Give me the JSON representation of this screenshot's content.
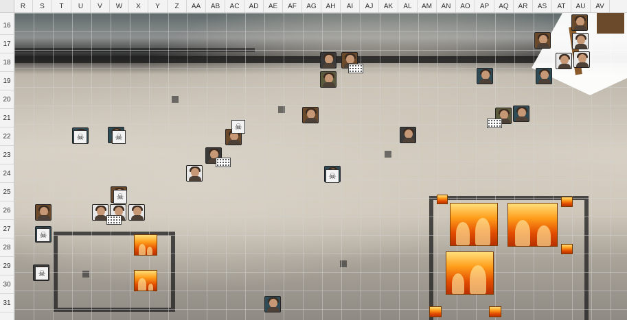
{
  "sheet": {
    "columns": [
      "R",
      "S",
      "T",
      "U",
      "V",
      "W",
      "X",
      "Y",
      "Z",
      "AA",
      "AB",
      "AC",
      "AD",
      "AE",
      "AF",
      "AG",
      "AH",
      "AI",
      "AJ",
      "AK",
      "AL",
      "AM",
      "AN",
      "AO",
      "AP",
      "AQ",
      "AR",
      "AS",
      "AT",
      "AU",
      "AV"
    ],
    "rows": [
      "16",
      "17",
      "18",
      "19",
      "20",
      "21",
      "22",
      "23",
      "24",
      "25",
      "26",
      "27",
      "28",
      "29",
      "30",
      "31"
    ]
  },
  "map": {
    "icons": {
      "portrait": "character-token",
      "skull": "skull-icon",
      "noise": "status-marker",
      "fire": "fire-hazard"
    },
    "colors": {
      "header_bg": "#f3f3f3",
      "grid_line": "#d6d6d6",
      "fire_hot": "#ff9d1b",
      "fire_core": "#e24d00"
    }
  }
}
